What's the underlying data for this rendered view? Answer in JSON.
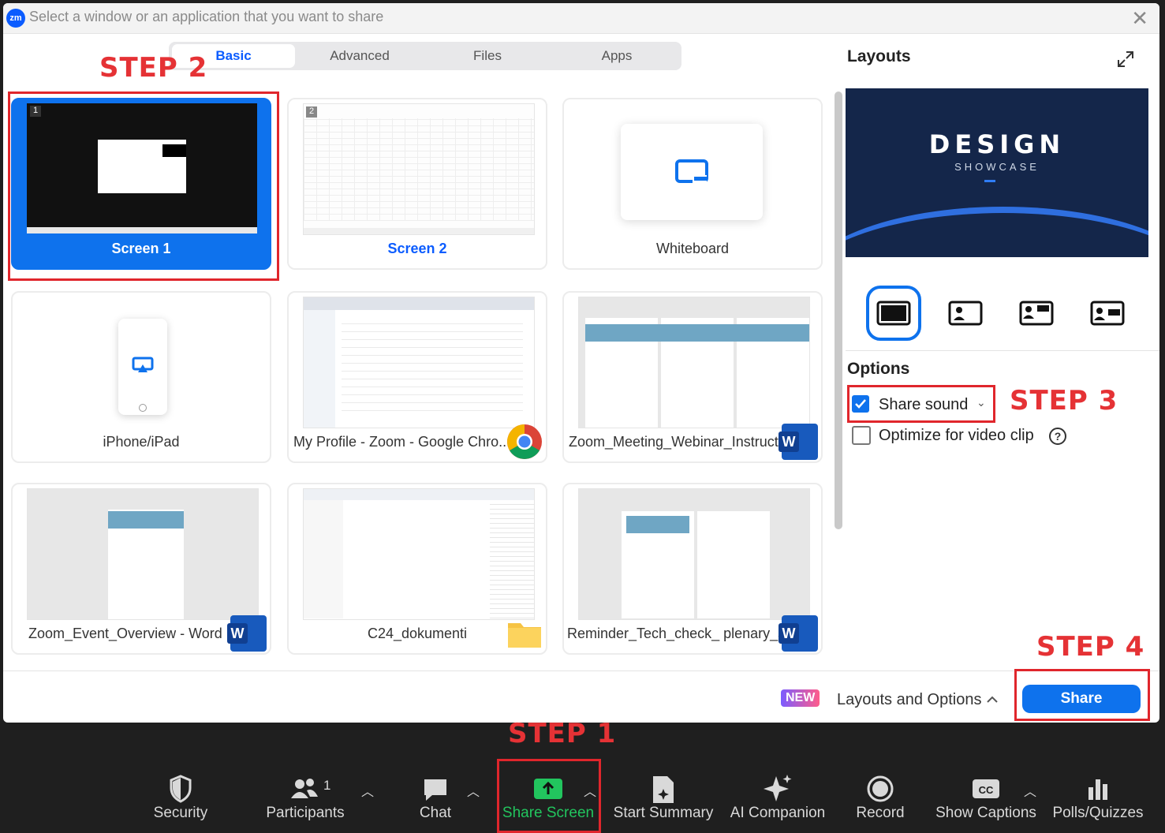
{
  "dialog": {
    "logo_text": "zm",
    "title": "Select a window or an application that you want to share"
  },
  "tabs": [
    "Basic",
    "Advanced",
    "Files",
    "Apps"
  ],
  "steps": {
    "step1": "STEP 1",
    "step2": "STEP 2",
    "step3": "STEP 3",
    "step4": "STEP 4"
  },
  "sources": [
    {
      "label": "Screen 1",
      "badge": "1",
      "selected": true
    },
    {
      "label": "Screen 2",
      "badge": "2"
    },
    {
      "label": "Whiteboard"
    },
    {
      "label": "iPhone/iPad"
    },
    {
      "label": "My Profile - Zoom - Google Chro...",
      "app_icon": "chrome-icon"
    },
    {
      "label": "Zoom_Meeting_Webinar_Instructi...",
      "app_icon": "word-icon"
    },
    {
      "label": "Zoom_Event_Overview - Word",
      "app_icon": "word-icon"
    },
    {
      "label": "C24_dokumenti",
      "app_icon": "folder-icon"
    },
    {
      "label": "Reminder_Tech_check_ plenary_sp...",
      "app_icon": "word-icon"
    }
  ],
  "layouts": {
    "heading": "Layouts",
    "preview_title": "DESIGN",
    "preview_subtitle": "SHOWCASE",
    "icons": [
      "layout-fullscreen-icon",
      "layout-presenter-left-icon",
      "layout-presenter-top-icon",
      "layout-presenter-right-icon"
    ]
  },
  "options": {
    "heading": "Options",
    "share_sound": {
      "label": "Share sound",
      "checked": true
    },
    "optimize_video": {
      "label": "Optimize for video clip",
      "checked": false
    }
  },
  "footer": {
    "new_badge": "NEW",
    "layouts_and_options": "Layouts and Options",
    "share_button": "Share"
  },
  "toolbar": {
    "security": "Security",
    "participants": "Participants",
    "participants_count": "1",
    "chat": "Chat",
    "share_screen": "Share Screen",
    "start_summary": "Start Summary",
    "ai_companion": "AI Companion",
    "record": "Record",
    "show_captions": "Show Captions",
    "polls": "Polls/Quizzes"
  },
  "colors": {
    "accent": "#0e72ed",
    "step_red": "#e53235",
    "share_green": "#22c55e"
  }
}
